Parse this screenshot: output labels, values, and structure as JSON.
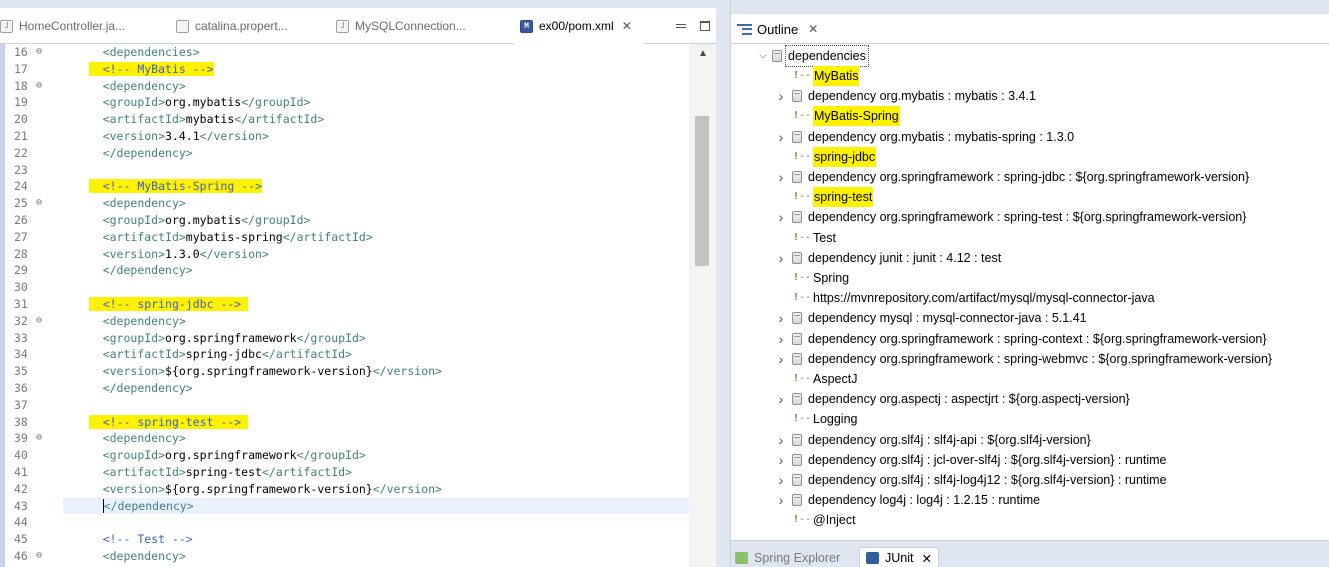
{
  "editor": {
    "tabs": [
      {
        "label": "HomeController.ja...",
        "icon": "java-file-icon",
        "active": false
      },
      {
        "label": "catalina.propert...",
        "icon": "text-file-icon",
        "active": false
      },
      {
        "label": "MySQLConnection...",
        "icon": "java-file-icon",
        "active": false
      },
      {
        "label": "ex00/pom.xml",
        "icon": "maven-pom-icon",
        "active": true,
        "close": "✕"
      }
    ],
    "lines": [
      {
        "n": "16",
        "fold": "⊖",
        "html": "    <span class=\"tag\">&lt;dependencies&gt;</span>"
      },
      {
        "n": "17",
        "fold": "",
        "html": "  <span class=\"hl\">  <span class=\"cmt\">&lt;!-- MyBatis --&gt;</span></span>"
      },
      {
        "n": "18",
        "fold": "⊖",
        "html": "    <span class=\"tag\">&lt;dependency&gt;</span>"
      },
      {
        "n": "19",
        "fold": "",
        "html": "    <span class=\"tag\">&lt;groupId&gt;</span>org.mybatis<span class=\"tag\">&lt;/groupId&gt;</span>"
      },
      {
        "n": "20",
        "fold": "",
        "html": "    <span class=\"tag\">&lt;artifactId&gt;</span>mybatis<span class=\"tag\">&lt;/artifactId&gt;</span>"
      },
      {
        "n": "21",
        "fold": "",
        "html": "    <span class=\"tag\">&lt;version&gt;</span>3.4.1<span class=\"tag\">&lt;/version&gt;</span>"
      },
      {
        "n": "22",
        "fold": "",
        "html": "    <span class=\"tag\">&lt;/dependency&gt;</span>"
      },
      {
        "n": "23",
        "fold": "",
        "html": ""
      },
      {
        "n": "24",
        "fold": "",
        "html": "  <span class=\"hl\">  <span class=\"cmt\">&lt;!-- MyBatis-Spring --&gt;</span></span>"
      },
      {
        "n": "25",
        "fold": "⊖",
        "html": "    <span class=\"tag\">&lt;dependency&gt;</span>"
      },
      {
        "n": "26",
        "fold": "",
        "html": "    <span class=\"tag\">&lt;groupId&gt;</span>org.mybatis<span class=\"tag\">&lt;/groupId&gt;</span>"
      },
      {
        "n": "27",
        "fold": "",
        "html": "    <span class=\"tag\">&lt;artifactId&gt;</span>mybatis-spring<span class=\"tag\">&lt;/artifactId&gt;</span>"
      },
      {
        "n": "28",
        "fold": "",
        "html": "    <span class=\"tag\">&lt;version&gt;</span>1.3.0<span class=\"tag\">&lt;/version&gt;</span>"
      },
      {
        "n": "29",
        "fold": "",
        "html": "    <span class=\"tag\">&lt;/dependency&gt;</span>"
      },
      {
        "n": "30",
        "fold": "",
        "html": ""
      },
      {
        "n": "31",
        "fold": "",
        "html": "  <span class=\"hl\">  <span class=\"cmt\">&lt;!-- spring-jdbc --&gt;</span> </span>"
      },
      {
        "n": "32",
        "fold": "⊖",
        "html": "    <span class=\"tag\">&lt;dependency&gt;</span>"
      },
      {
        "n": "33",
        "fold": "",
        "html": "    <span class=\"tag\">&lt;groupId&gt;</span>org.springframework<span class=\"tag\">&lt;/groupId&gt;</span>"
      },
      {
        "n": "34",
        "fold": "",
        "html": "    <span class=\"tag\">&lt;artifactId&gt;</span>spring-jdbc<span class=\"tag\">&lt;/artifactId&gt;</span>"
      },
      {
        "n": "35",
        "fold": "",
        "html": "    <span class=\"tag\">&lt;version&gt;</span>${org.springframework-version}<span class=\"tag\">&lt;/version&gt;</span>"
      },
      {
        "n": "36",
        "fold": "",
        "html": "    <span class=\"tag\">&lt;/dependency&gt;</span>"
      },
      {
        "n": "37",
        "fold": "",
        "html": ""
      },
      {
        "n": "38",
        "fold": "",
        "html": "  <span class=\"hl\">  <span class=\"cmt\">&lt;!-- spring-test --&gt;</span> </span>"
      },
      {
        "n": "39",
        "fold": "⊖",
        "html": "    <span class=\"tag\">&lt;dependency&gt;</span>"
      },
      {
        "n": "40",
        "fold": "",
        "html": "    <span class=\"tag\">&lt;groupId&gt;</span>org.springframework<span class=\"tag\">&lt;/groupId&gt;</span>"
      },
      {
        "n": "41",
        "fold": "",
        "html": "    <span class=\"tag\">&lt;artifactId&gt;</span>spring-test<span class=\"tag\">&lt;/artifactId&gt;</span>"
      },
      {
        "n": "42",
        "fold": "",
        "html": "    <span class=\"tag\">&lt;version&gt;</span>${org.springframework-version}<span class=\"tag\">&lt;/version&gt;</span>"
      },
      {
        "n": "43",
        "fold": "",
        "html": "    <span class=\"caret\"></span><span class=\"tag\">&lt;/dependency&gt;</span>",
        "current": true
      },
      {
        "n": "44",
        "fold": "",
        "html": ""
      },
      {
        "n": "45",
        "fold": "",
        "html": "    <span class=\"cmt\">&lt;!-- Test --&gt;</span>"
      },
      {
        "n": "46",
        "fold": "⊖",
        "html": "    <span class=\"tag\">&lt;dependency&gt;</span>"
      }
    ]
  },
  "outline": {
    "tab_label": "Outline",
    "tab_close": "✕",
    "root": "dependencies",
    "items": [
      {
        "kind": "comment",
        "text": "MyBatis",
        "highlight": true
      },
      {
        "kind": "dep",
        "text": "dependency  org.mybatis : mybatis : 3.4.1"
      },
      {
        "kind": "comment",
        "text": "MyBatis-Spring",
        "highlight": true
      },
      {
        "kind": "dep",
        "text": "dependency  org.mybatis : mybatis-spring : 1.3.0"
      },
      {
        "kind": "comment",
        "text": "spring-jdbc",
        "highlight": true
      },
      {
        "kind": "dep",
        "text": "dependency  org.springframework : spring-jdbc : ${org.springframework-version}"
      },
      {
        "kind": "comment",
        "text": "spring-test",
        "highlight": true
      },
      {
        "kind": "dep",
        "text": "dependency  org.springframework : spring-test : ${org.springframework-version}"
      },
      {
        "kind": "comment",
        "text": "Test",
        "highlight": false
      },
      {
        "kind": "dep",
        "text": "dependency  junit : junit : 4.12 : test"
      },
      {
        "kind": "comment",
        "text": "Spring",
        "highlight": false
      },
      {
        "kind": "comment",
        "text": "https://mvnrepository.com/artifact/mysql/mysql-connector-java",
        "highlight": false
      },
      {
        "kind": "dep",
        "text": "dependency  mysql : mysql-connector-java : 5.1.41"
      },
      {
        "kind": "dep",
        "text": "dependency  org.springframework : spring-context : ${org.springframework-version}"
      },
      {
        "kind": "dep",
        "text": "dependency  org.springframework : spring-webmvc : ${org.springframework-version}"
      },
      {
        "kind": "comment",
        "text": "AspectJ",
        "highlight": false
      },
      {
        "kind": "dep",
        "text": "dependency  org.aspectj : aspectjrt : ${org.aspectj-version}"
      },
      {
        "kind": "comment",
        "text": "Logging",
        "highlight": false
      },
      {
        "kind": "dep",
        "text": "dependency  org.slf4j : slf4j-api : ${org.slf4j-version}"
      },
      {
        "kind": "dep",
        "text": "dependency  org.slf4j : jcl-over-slf4j : ${org.slf4j-version} : runtime"
      },
      {
        "kind": "dep",
        "text": "dependency  org.slf4j : slf4j-log4j12 : ${org.slf4j-version} : runtime"
      },
      {
        "kind": "dep",
        "text": "dependency  log4j : log4j : 1.2.15 : runtime"
      },
      {
        "kind": "comment",
        "text": "@Inject",
        "highlight": false
      }
    ],
    "comment_prefix": "<!--",
    "bottom_tabs": [
      {
        "label": "Spring Explorer",
        "active": false
      },
      {
        "label": "JUnit",
        "active": true,
        "close": "✕"
      }
    ]
  }
}
